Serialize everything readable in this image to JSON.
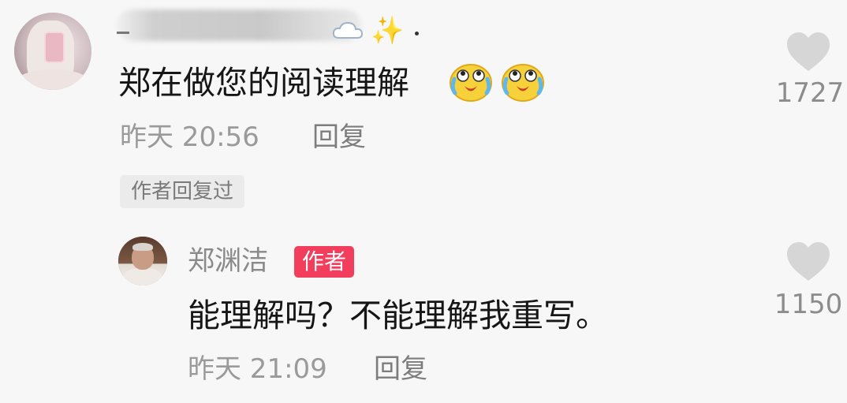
{
  "comment": {
    "username_blurred": "_",
    "text": "郑在做您的阅读理解",
    "emojis": [
      "crying-laughing-emoji",
      "crying-laughing-emoji"
    ],
    "time": "昨天 20:56",
    "reply_label": "回复",
    "author_replied_tag": "作者回复过",
    "like_count": "1727"
  },
  "reply": {
    "username": "郑渊洁",
    "author_badge": "作者",
    "text": "能理解吗？不能理解我重写。",
    "time": "昨天 21:09",
    "reply_label": "回复",
    "like_count": "1150"
  },
  "icons": {
    "like": "heart-icon",
    "decoration": [
      "cloud-icon",
      "sparkle-icon"
    ]
  },
  "colors": {
    "background": "#f7f7f7",
    "author_badge": "#f23d5c",
    "muted_text": "#9a9a9a",
    "heart": "#d6d6d6"
  }
}
